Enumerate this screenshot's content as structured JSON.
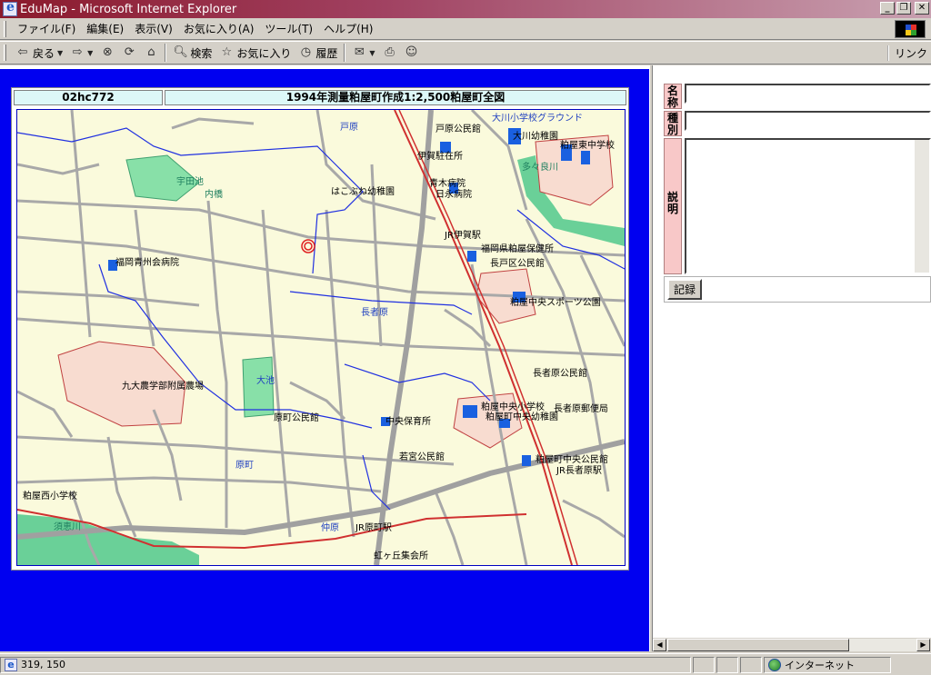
{
  "window": {
    "title": "EduMap - Microsoft Internet Explorer"
  },
  "menu": [
    "ファイル(F)",
    "編集(E)",
    "表示(V)",
    "お気に入り(A)",
    "ツール(T)",
    "ヘルプ(H)"
  ],
  "toolbar": {
    "back": "戻る",
    "search": "検索",
    "favorites": "お気に入り",
    "history": "履歴",
    "links": "リンク"
  },
  "map": {
    "id": "02hc772",
    "title": "1994年測量粕屋町作成1:2,500粕屋町全図",
    "labels": {
      "l1": "戸原",
      "l2": "戸原公民館",
      "l3": "大川小学校グラウンド",
      "l4": "大川幼稚園",
      "l5": "粕屋東中学校",
      "l6": "伊賀駐在所",
      "l7": "宇田池",
      "l8": "内橋",
      "l9": "はこぶね幼稚園",
      "l10": "青木病院",
      "l11": "日永病院",
      "l12": "JR伊賀駅",
      "l13": "福岡県粕屋保健所",
      "l14": "長戸区公民館",
      "l15": "福岡青州会病院",
      "l16": "粕屋中央スポーツ公園",
      "l17": "長者原",
      "l18": "九大農学部附属農場",
      "l19": "大池",
      "l20": "長者原公民館",
      "l21": "粕屋中央小学校",
      "l22": "長者原郵便局",
      "l23": "粕屋町中央幼稚園",
      "l24": "原町公民館",
      "l25": "中央保育所",
      "l26": "若宮公民館",
      "l27": "原町",
      "l28": "粕屋町中央公民館",
      "l29": "JR長者原駅",
      "l30": "粕屋西小学校",
      "l31": "須恵川",
      "l32": "仲原",
      "l33": "JR原町駅",
      "l34": "虹ヶ丘集会所",
      "l35": "多々良川"
    }
  },
  "form": {
    "name_label": "名称",
    "type_label": "種別",
    "desc_label": "説明",
    "name_value": "",
    "type_value": "",
    "submit": "記録"
  },
  "status": {
    "coords": "319, 150",
    "zone": "インターネット"
  }
}
